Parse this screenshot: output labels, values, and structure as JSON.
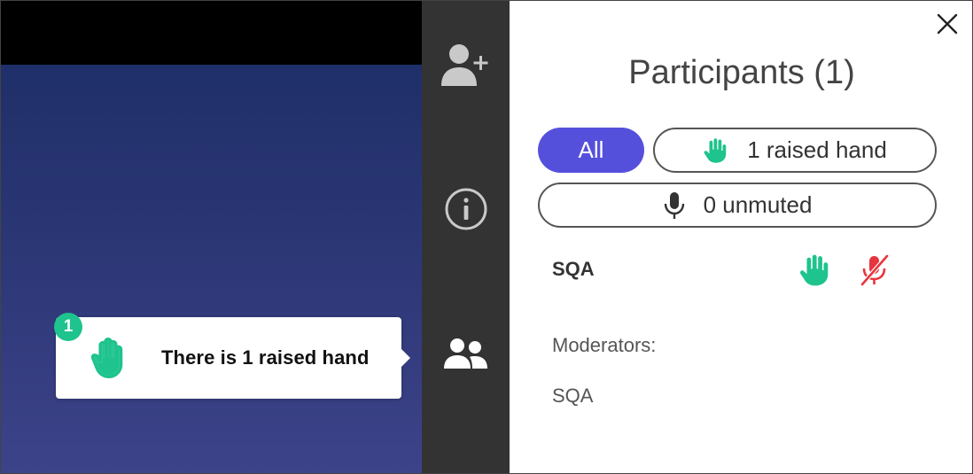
{
  "tooltip": {
    "text": "There is 1 raised hand"
  },
  "sidebar": {
    "participants_badge": "1"
  },
  "panel": {
    "title": "Participants (1)",
    "filters": {
      "all_label": "All",
      "raised_label": "1 raised hand",
      "unmuted_label": "0 unmuted"
    },
    "participants": [
      {
        "name": "SQA",
        "hand_raised": true,
        "muted": true
      }
    ],
    "moderators_label": "Moderators:",
    "moderators": [
      "SQA"
    ]
  },
  "colors": {
    "accent": "#5550db",
    "hand": "#1ec38d",
    "muted": "#e8343e",
    "sidebar": "#333333",
    "badge": "#1ec38d"
  },
  "icons": {
    "add_user": "add-user-icon",
    "info": "info-icon",
    "participants": "participants-icon",
    "close": "close-icon",
    "hand": "raised-hand-icon",
    "mic": "microphone-icon",
    "mic_muted": "microphone-muted-icon"
  }
}
